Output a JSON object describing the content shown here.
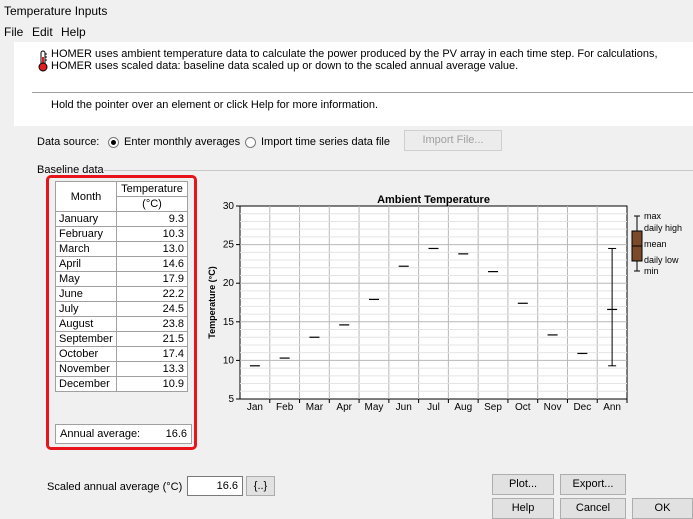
{
  "window": {
    "title": "Temperature Inputs"
  },
  "menu": [
    "File",
    "Edit",
    "Help"
  ],
  "info": {
    "text": "HOMER uses ambient temperature data to calculate the power produced by the PV array in each time step. For calculations, HOMER uses scaled data: baseline data scaled up or down to the scaled annual average value.",
    "hint": "Hold the pointer over an element or click Help for more information.",
    "icon": "thermometer-icon"
  },
  "data_source": {
    "label": "Data source:",
    "options": [
      "Enter monthly averages",
      "Import time series data file"
    ],
    "selected": "Enter monthly averages",
    "import_button": "Import File..."
  },
  "baseline": {
    "group_label": "Baseline data",
    "col_month": "Month",
    "col_temp_line1": "Temperature",
    "col_temp_line2": "(°C)",
    "rows": [
      {
        "month": "January",
        "value": "9.3"
      },
      {
        "month": "February",
        "value": "10.3"
      },
      {
        "month": "March",
        "value": "13.0"
      },
      {
        "month": "April",
        "value": "14.6"
      },
      {
        "month": "May",
        "value": "17.9"
      },
      {
        "month": "June",
        "value": "22.2"
      },
      {
        "month": "July",
        "value": "24.5"
      },
      {
        "month": "August",
        "value": "23.8"
      },
      {
        "month": "September",
        "value": "21.5"
      },
      {
        "month": "October",
        "value": "17.4"
      },
      {
        "month": "November",
        "value": "13.3"
      },
      {
        "month": "December",
        "value": "10.9"
      }
    ],
    "annual_label": "Annual average:",
    "annual_value": "16.6"
  },
  "chart_data": {
    "type": "line",
    "title": "Ambient Temperature",
    "ylabel": "Temperature (°C)",
    "xlabel": "",
    "categories": [
      "Jan",
      "Feb",
      "Mar",
      "Apr",
      "May",
      "Jun",
      "Jul",
      "Aug",
      "Sep",
      "Oct",
      "Nov",
      "Dec",
      "Ann"
    ],
    "values": [
      9.3,
      10.3,
      13.0,
      14.6,
      17.9,
      22.2,
      24.5,
      23.8,
      21.5,
      17.4,
      13.3,
      10.9,
      16.6
    ],
    "annual_min": 9.3,
    "annual_max": 24.5,
    "ylim": [
      5,
      30
    ],
    "yticks": [
      5,
      10,
      15,
      20,
      25,
      30
    ],
    "grid": true,
    "legend_position": "right",
    "legend": [
      "max",
      "daily high",
      "mean",
      "daily low",
      "min"
    ],
    "colors": {
      "box": "#7b4a2a"
    }
  },
  "bottom": {
    "scaled_label": "Scaled annual average (°C)",
    "scaled_value": "16.6",
    "efficiency_button": "{..}",
    "plot_button": "Plot...",
    "export_button": "Export...",
    "help_button": "Help",
    "cancel_button": "Cancel",
    "ok_button": "OK"
  }
}
